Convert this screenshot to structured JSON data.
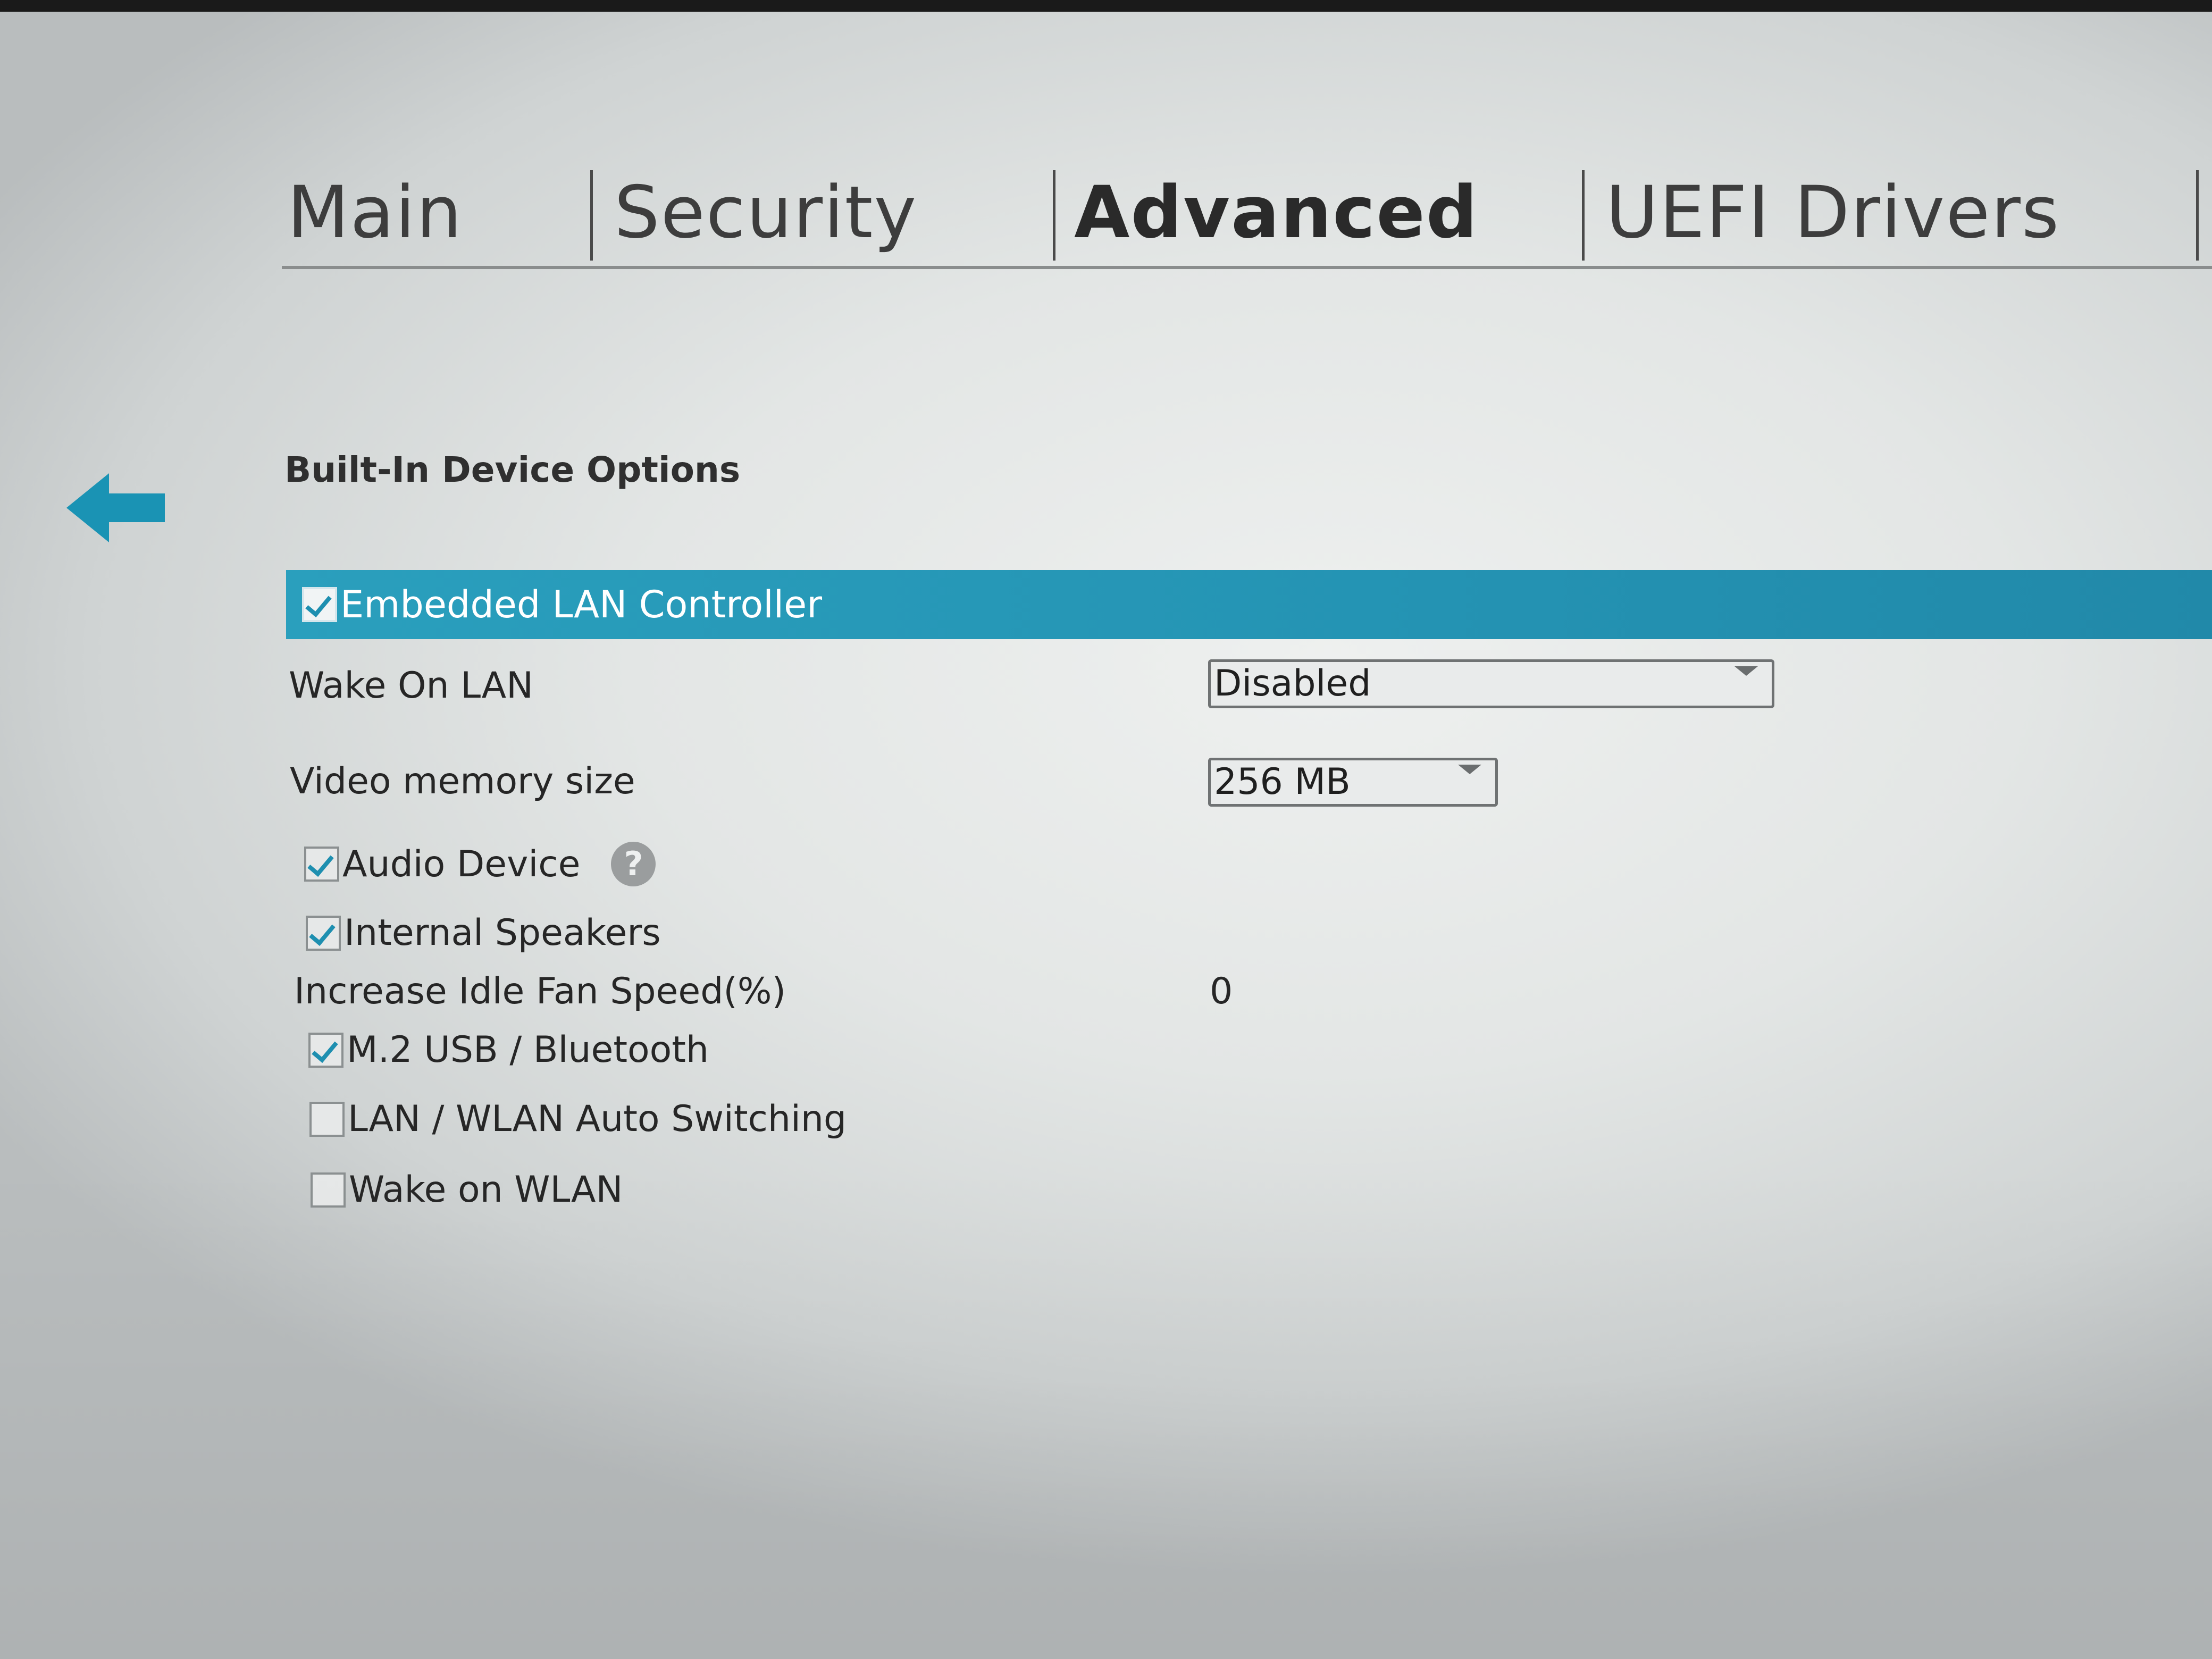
{
  "tabs": [
    {
      "label": "Main"
    },
    {
      "label": "Security"
    },
    {
      "label": "Advanced"
    },
    {
      "label": "UEFI Drivers"
    }
  ],
  "active_tab": "Advanced",
  "section_title": "Built-In Device Options",
  "icons": {
    "back": "back-arrow-icon",
    "help": "help-icon",
    "dropdown": "chevron-down-icon"
  },
  "colors": {
    "accent": "#2a9fbd",
    "check": "#1e8fb0",
    "back_arrow": "#1a93b4"
  },
  "settings": {
    "embedded_lan": {
      "label": "Embedded LAN Controller",
      "checked": true
    },
    "wake_on_lan": {
      "label": "Wake On LAN",
      "value": "Disabled"
    },
    "video_memory": {
      "label": "Video memory size",
      "value": "256 MB"
    },
    "audio_device": {
      "label": "Audio Device",
      "checked": true,
      "help": "?"
    },
    "internal_speakers": {
      "label": "Internal Speakers",
      "checked": true
    },
    "idle_fan": {
      "label": "Increase Idle Fan Speed(%)",
      "value": "0"
    },
    "m2_usb_bt": {
      "label": "M.2 USB / Bluetooth",
      "checked": true
    },
    "lan_wlan_switch": {
      "label": "LAN / WLAN Auto Switching",
      "checked": false
    },
    "wake_on_wlan": {
      "label": "Wake on WLAN",
      "checked": false
    }
  }
}
